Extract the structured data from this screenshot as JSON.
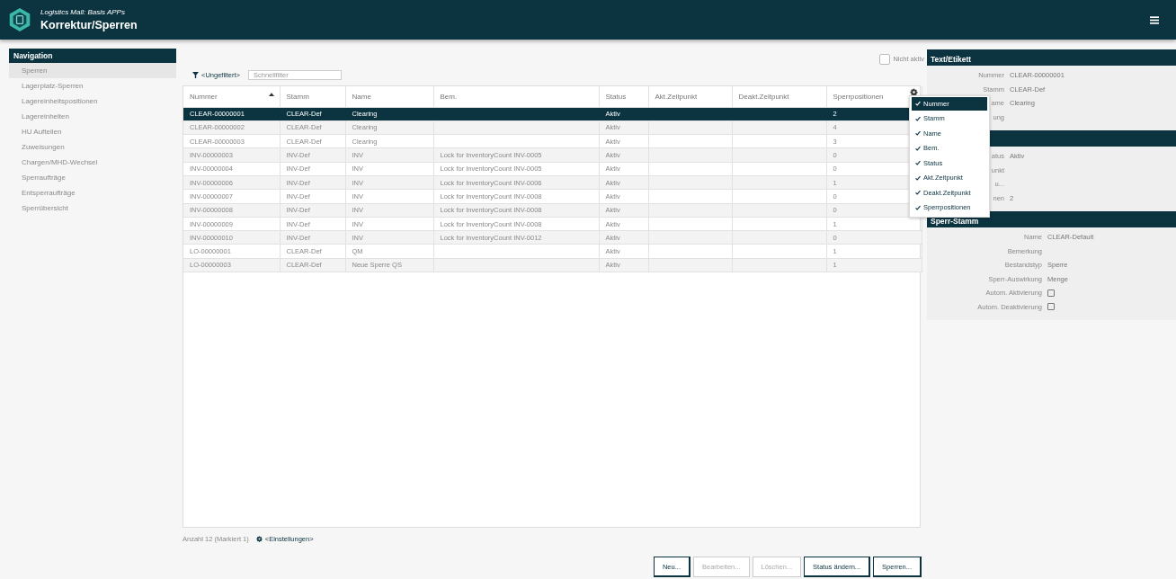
{
  "app": {
    "subtitle": "Logistics Mall: Basis APPs",
    "title": "Korrektur/Sperren"
  },
  "navigation": {
    "title": "Navigation",
    "items": [
      {
        "label": "Sperren",
        "selected": true
      },
      {
        "label": "Lagerplatz-Sperren",
        "selected": false
      },
      {
        "label": "Lagereinheitspositionen",
        "selected": false
      },
      {
        "label": "Lagereinheiten",
        "selected": false
      },
      {
        "label": "HU Aufteilen",
        "selected": false
      },
      {
        "label": "Zuweisungen",
        "selected": false
      },
      {
        "label": "Chargen/MHD-Wechsel",
        "selected": false
      },
      {
        "label": "Sperraufträge",
        "selected": false
      },
      {
        "label": "Entsperraufträge",
        "selected": false
      },
      {
        "label": "Sperrübersicht",
        "selected": false
      }
    ]
  },
  "toolbar": {
    "filter_label": "<Ungefiltert>",
    "quick_filter": {
      "placeholder": "Schnellfilter"
    },
    "inactive_toggle": {
      "label": "Nicht aktiv",
      "checked": false
    }
  },
  "table": {
    "columns": [
      {
        "label": "Nummer",
        "sort_ascending": true
      },
      {
        "label": "Stamm"
      },
      {
        "label": "Name"
      },
      {
        "label": "Bem."
      },
      {
        "label": "Status"
      },
      {
        "label": "Akt.Zeitpunkt"
      },
      {
        "label": "Deakt.Zeitpunkt"
      },
      {
        "label": "Sperrpositionen"
      }
    ],
    "rows": [
      {
        "selected": true,
        "cells": [
          "CLEAR-00000001",
          "CLEAR-Def",
          "Clearing",
          null,
          "Aktiv",
          null,
          null,
          "2"
        ]
      },
      {
        "selected": false,
        "cells": [
          "CLEAR-00000002",
          "CLEAR-Def",
          "Clearing",
          null,
          "Aktiv",
          null,
          null,
          "4"
        ]
      },
      {
        "selected": false,
        "cells": [
          "CLEAR-00000003",
          "CLEAR-Def",
          "Clearing",
          null,
          "Aktiv",
          null,
          null,
          "3"
        ]
      },
      {
        "selected": false,
        "cells": [
          "INV-00000003",
          "INV-Def",
          "INV",
          "Lock for InventoryCount INV-0005",
          "Aktiv",
          null,
          null,
          "0"
        ]
      },
      {
        "selected": false,
        "cells": [
          "INV-00000004",
          "INV-Def",
          "INV",
          "Lock for InventoryCount INV-0005",
          "Aktiv",
          null,
          null,
          "0"
        ]
      },
      {
        "selected": false,
        "cells": [
          "INV-00000006",
          "INV-Def",
          "INV",
          "Lock for InventoryCount INV-0006",
          "Aktiv",
          null,
          null,
          "1"
        ]
      },
      {
        "selected": false,
        "cells": [
          "INV-00000007",
          "INV-Def",
          "INV",
          "Lock for InventoryCount INV-0008",
          "Aktiv",
          null,
          null,
          "0"
        ]
      },
      {
        "selected": false,
        "cells": [
          "INV-00000008",
          "INV-Def",
          "INV",
          "Lock for InventoryCount INV-0008",
          "Aktiv",
          null,
          null,
          "0"
        ]
      },
      {
        "selected": false,
        "cells": [
          "INV-00000009",
          "INV-Def",
          "INV",
          "Lock for InventoryCount INV-0008",
          "Aktiv",
          null,
          null,
          "1"
        ]
      },
      {
        "selected": false,
        "cells": [
          "INV-00000010",
          "INV-Def",
          "INV",
          "Lock for InventoryCount INV-0012",
          "Aktiv",
          null,
          null,
          "0"
        ]
      },
      {
        "selected": false,
        "cells": [
          "LO-00000001",
          "CLEAR-Def",
          "QM",
          null,
          "Aktiv",
          null,
          null,
          "1"
        ]
      },
      {
        "selected": false,
        "cells": [
          "LO-00000003",
          "CLEAR-Def",
          "Neue Sperre QS",
          null,
          "Aktiv",
          null,
          null,
          "1"
        ]
      }
    ]
  },
  "footer": {
    "count": "Anzahl 12 (Markiert 1)",
    "settings_label": "<Einstellungen>"
  },
  "buttons": [
    {
      "label": "Neu...",
      "disabled": false
    },
    {
      "label": "Bearbeiten...",
      "disabled": true
    },
    {
      "label": "Löschen...",
      "disabled": true
    },
    {
      "label": "Status ändern...",
      "disabled": false
    },
    {
      "label": "Sperren...",
      "disabled": false
    }
  ],
  "column_menu": {
    "items": [
      {
        "label": "Nummer",
        "checked": true,
        "selected": true
      },
      {
        "label": "Stamm",
        "checked": true,
        "selected": false
      },
      {
        "label": "Name",
        "checked": true,
        "selected": false
      },
      {
        "label": "Bem.",
        "checked": true,
        "selected": false
      },
      {
        "label": "Status",
        "checked": true,
        "selected": false
      },
      {
        "label": "Akt.Zeitpunkt",
        "checked": true,
        "selected": false
      },
      {
        "label": "Deakt.Zeitpunkt",
        "checked": true,
        "selected": false
      },
      {
        "label": "Sperrpositionen",
        "checked": true,
        "selected": false
      }
    ]
  },
  "detail_panel": {
    "sections": [
      {
        "title": "Text/Etikett",
        "fields": [
          {
            "kind": "text",
            "label": "Nummer",
            "value": "CLEAR-00000001"
          },
          {
            "kind": "text",
            "label": "Stamm",
            "value": "CLEAR-Def"
          },
          {
            "kind": "text",
            "label": "ame",
            "value": "Clearing"
          },
          {
            "kind": "text",
            "label": "ung"
          }
        ]
      },
      {
        "fields": [
          {
            "kind": "text",
            "label": "atus",
            "value": "Aktiv"
          },
          {
            "kind": "text",
            "label": "unkt"
          },
          {
            "kind": "text",
            "label": "u..."
          },
          {
            "kind": "text",
            "label": "nen",
            "value": "2"
          }
        ]
      },
      {
        "title": "Sperr-Stamm",
        "fields": [
          {
            "kind": "text",
            "label": "Name",
            "value": "CLEAR-Default"
          },
          {
            "kind": "text",
            "label": "Bemerkung"
          },
          {
            "kind": "text",
            "label": "Bestandstyp",
            "value": "Sperre"
          },
          {
            "kind": "text",
            "label": "Sperr-Auswirkung",
            "value": "Menge"
          },
          {
            "kind": "checkbox",
            "label": "Autom. Aktivierung",
            "checked": false
          },
          {
            "kind": "checkbox",
            "label": "Autom. Deaktivierung",
            "checked": false
          }
        ]
      }
    ]
  }
}
